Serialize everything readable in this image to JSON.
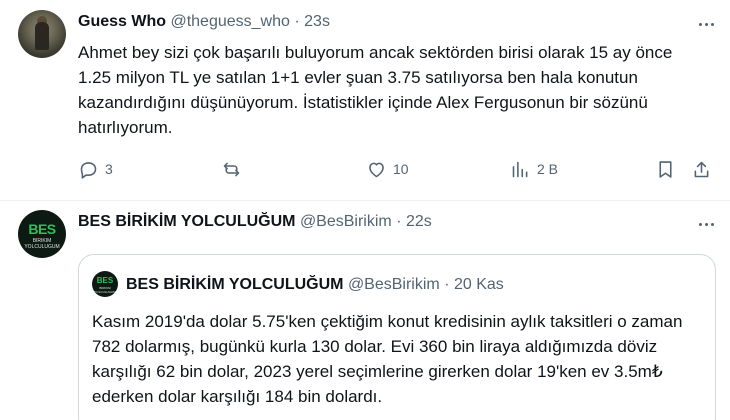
{
  "tweet1": {
    "author_name": "Guess Who",
    "handle": "@theguess_who",
    "separator": "·",
    "time": "23s",
    "text": "Ahmet bey sizi çok başarılı buluyorum ancak sektörden birisi olarak 15 ay önce 1.25 milyon TL ye satılan 1+1 evler şuan 3.75 satılıyorsa ben hala konutun kazandırdığını düşünüyorum. İstatistikler içinde Alex Fergusonun bir sözünü hatırlıyorum.",
    "replies": "3",
    "reposts": "",
    "likes": "10",
    "views": "2 B",
    "icons": [
      "more-icon",
      "reply-icon",
      "repost-icon",
      "like-icon",
      "views-icon",
      "bookmark-icon",
      "share-icon"
    ]
  },
  "tweet2": {
    "author_name": "BES BİRİKİM YOLCULUĞUM",
    "handle": "@BesBirikim",
    "separator": "·",
    "time": "22s",
    "avatar_logo": "BES",
    "avatar_sub": "BIRIKIM YOLCULUGUM",
    "quote": {
      "author_name": "BES BİRİKİM YOLCULUĞUM",
      "handle": "@BesBirikim",
      "separator": "·",
      "time": "20 Kas",
      "text": "Kasım 2019'da dolar 5.75'ken çektiğim konut kredisinin aylık taksitleri o zaman 782 dolarmış, bugünkü kurla 130 dolar. Evi 360 bin liraya aldığımızda döviz karşılığı 62 bin dolar, 2023 yerel seçimlerine girerken dolar 19'ken ev 3.5m₺ ederken dolar karşılığı 184 bin dolardı."
    }
  },
  "colors": {
    "text_primary": "#0f1419",
    "text_secondary": "#536471",
    "border": "#cfd9de",
    "logo_green": "#2fbf5b"
  }
}
